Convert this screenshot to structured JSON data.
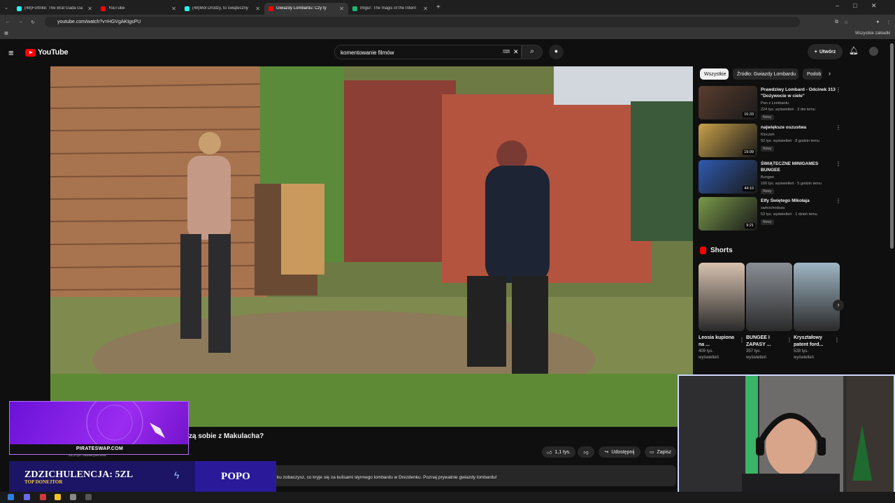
{
  "browser": {
    "tabs": [
      {
        "title": "(48)Fortnite: The Brat Gada Ga",
        "color": "#25f4ee"
      },
      {
        "title": "YouTube",
        "color": "#ff0000"
      },
      {
        "title": "(48)Mol Drodzy, to świąteczny",
        "color": "#25f4ee"
      },
      {
        "title": "Gwiazdy Lombardu: Czy ty",
        "color": "#ff0000",
        "active": true
      },
      {
        "title": "Imgur: The magic of the Intern",
        "color": "#1bb76e"
      }
    ],
    "url": "youtube.com/watch?v=HGVgAKtgsPU",
    "bookmarks_label": "Wszystkie zakładki"
  },
  "youtube": {
    "logo": "YouTube",
    "search_value": "komentowanie filmów",
    "create_label": "Utwórz"
  },
  "video": {
    "title_visible": "zą sobie z Makulacha?",
    "likes": "1,1 tys.",
    "share_label": "Udostępnij",
    "save_label": "Zapisz",
    "description": "ku zobaczysz, co kryje się za kulisami słynnego lombardu w Drezdenku. Poznaj prywatnie gwiazdy lombardu!",
    "channel_meta": "28,9 tys. subskrybentów"
  },
  "sidebar": {
    "chips": [
      "Wszystkie",
      "Źródło: Gwiazdy Lombardu",
      "Podob"
    ],
    "recommendations": [
      {
        "title": "Prawdziwy Lombard - Odcinek 313 \"Dożywocie w ciele\"",
        "channel": "Pan z Lombardu",
        "meta": "224 tys. wyświetleń · 3 dni temu",
        "duration": "16:33",
        "badge": "Nowy",
        "color": "#5a3d2e"
      },
      {
        "title": "największe oszustwa",
        "channel": "Kloczeh",
        "meta": "52 tys. wyświetleń · 8 godzin temu",
        "duration": "19:09",
        "badge": "Nowy",
        "color": "#c9a24a"
      },
      {
        "title": "ŚWIĄTECZNE MINIGAMES BUNGEE",
        "channel": "Bungee",
        "meta": "100 tys. wyświetleń · 5 godzin temu",
        "duration": "44:10",
        "badge": "Nowy",
        "color": "#2f5ab0"
      },
      {
        "title": "Elfy Świętego Mikołaja",
        "channel": "samochodoza",
        "meta": "53 tys. wyświetleń · 1 dzień temu",
        "duration": "9:21",
        "badge": "Nowy",
        "color": "#7a9a4a"
      }
    ],
    "shorts_title": "Shorts",
    "shorts": [
      {
        "title": "Leosia kupiona na ...",
        "views": "409 tys. wyświetleń",
        "color": "#d8c2b0"
      },
      {
        "title": "BUNGEE I ZAPASY ...",
        "views": "357 tys. wyświetleń",
        "color": "#8a8f96"
      },
      {
        "title": "Kryształowy patent ford...",
        "views": "528 tys. wyświetleń",
        "color": "#9fb6c4"
      }
    ]
  },
  "overlays": {
    "promo_text": "PIRATESWAP.COM",
    "donate_line": "ZDZICHULENCJA: 5ZL",
    "donate_sub": "TOP DONEJTOR",
    "donate_name": "POPO"
  }
}
